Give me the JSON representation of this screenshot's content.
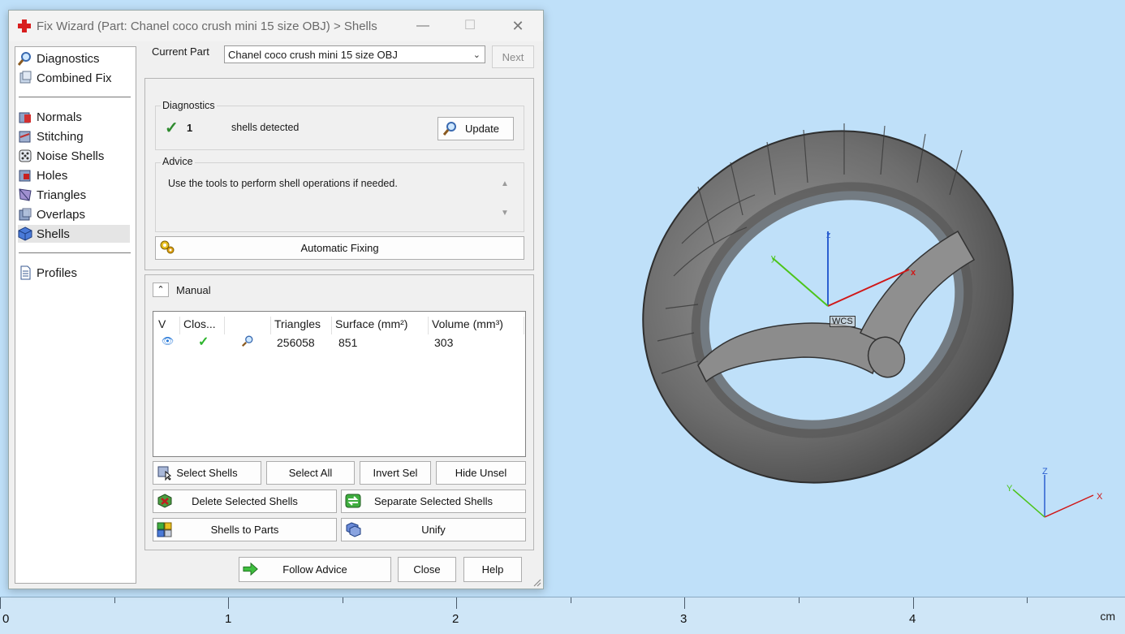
{
  "window": {
    "title": "Fix Wizard (Part: Chanel coco crush mini 15 size OBJ) > Shells",
    "minimize": "—",
    "maximize": "☐",
    "close": "✕"
  },
  "nav": {
    "top_items": [
      {
        "label": "Diagnostics",
        "icon": "magnifier-icon"
      },
      {
        "label": "Combined Fix",
        "icon": "stacked-cubes-icon"
      }
    ],
    "fix_items": [
      {
        "label": "Normals",
        "icon": "cube-red-face-icon"
      },
      {
        "label": "Stitching",
        "icon": "cube-stitch-icon"
      },
      {
        "label": "Noise Shells",
        "icon": "dice-icon"
      },
      {
        "label": "Holes",
        "icon": "cube-hole-icon"
      },
      {
        "label": "Triangles",
        "icon": "triangle-prism-icon"
      },
      {
        "label": "Overlaps",
        "icon": "cube-overlap-icon"
      },
      {
        "label": "Shells",
        "icon": "blue-cube-icon"
      }
    ],
    "bottom_items": [
      {
        "label": "Profiles",
        "icon": "document-icon"
      }
    ],
    "selected": "Shells"
  },
  "current_part": {
    "label": "Current Part",
    "value": "Chanel coco crush mini 15 size OBJ",
    "next_label": "Next"
  },
  "diagnostics": {
    "group_title": "Diagnostics",
    "count": "1",
    "message": "shells detected",
    "update_label": "Update"
  },
  "advice": {
    "group_title": "Advice",
    "text": "Use the tools to perform shell operations if needed."
  },
  "automatic_fixing_label": "Automatic Fixing",
  "manual": {
    "title": "Manual",
    "collapse": "⌃",
    "columns": [
      "V",
      "Clos...",
      "",
      "Triangles",
      "Surface (mm²)",
      "Volume (mm³)"
    ],
    "rows": [
      {
        "visible": "👁",
        "closed": "✓",
        "triangles": "256058",
        "surface": "851",
        "volume": "303"
      }
    ]
  },
  "buttons": {
    "select_shells": "Select Shells",
    "select_all": "Select All",
    "invert_sel": "Invert Sel",
    "hide_unsel": "Hide Unsel",
    "delete_selected": "Delete Selected Shells",
    "separate_selected": "Separate Selected Shells",
    "shells_to_parts": "Shells to Parts",
    "unify": "Unify",
    "follow_advice": "Follow Advice",
    "close": "Close",
    "help": "Help"
  },
  "viewport": {
    "origin_label": "WCS",
    "axes": {
      "x": "x",
      "y": "y",
      "z": "z"
    },
    "triad": {
      "x": "X",
      "y": "Y",
      "z": "Z"
    }
  },
  "ruler": {
    "labels": [
      "0",
      "1",
      "2",
      "3",
      "4"
    ],
    "unit": "cm"
  },
  "colors": {
    "viewport_bg": "#bfe0f9",
    "check_green": "#2e8b2e",
    "x_axis": "#d01818",
    "y_axis": "#4cc41a",
    "z_axis": "#2b5fd0"
  }
}
